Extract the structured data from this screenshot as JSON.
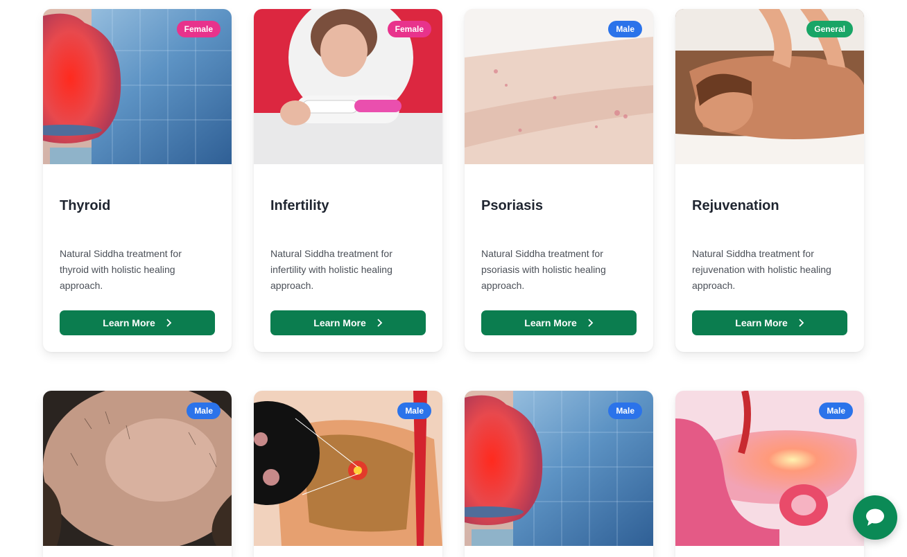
{
  "colors": {
    "primary_button": "#0b7d4f",
    "badge_female": "#e8338c",
    "badge_male": "#2b73ea",
    "badge_general": "#19a566",
    "chat_button": "#0b8a56"
  },
  "cards_row1": [
    {
      "title": "Thyroid",
      "badge": "Female",
      "description": "Natural Siddha treatment for thyroid with holistic healing approach.",
      "button_label": "Learn More",
      "image": "thyroid-illustration"
    },
    {
      "title": "Infertility",
      "badge": "Female",
      "description": "Natural Siddha treatment for infertility with holistic healing approach.",
      "button_label": "Learn More",
      "image": "pregnancy-test-photo"
    },
    {
      "title": "Psoriasis",
      "badge": "Male",
      "description": "Natural Siddha treatment for psoriasis with holistic healing approach.",
      "button_label": "Learn More",
      "image": "skin-arm-photo"
    },
    {
      "title": "Rejuvenation",
      "badge": "General",
      "description": "Natural Siddha treatment for rejuvenation with holistic healing approach.",
      "button_label": "Learn More",
      "image": "massage-photo"
    }
  ],
  "cards_row2": [
    {
      "badge": "Male",
      "image": "hair-loss-photo"
    },
    {
      "badge": "Male",
      "image": "liver-tissue-illustration"
    },
    {
      "badge": "Male",
      "image": "thyroid-illustration"
    },
    {
      "badge": "Male",
      "image": "pancreas-illustration"
    }
  ],
  "chat": {
    "icon": "chat-bubble-icon"
  }
}
